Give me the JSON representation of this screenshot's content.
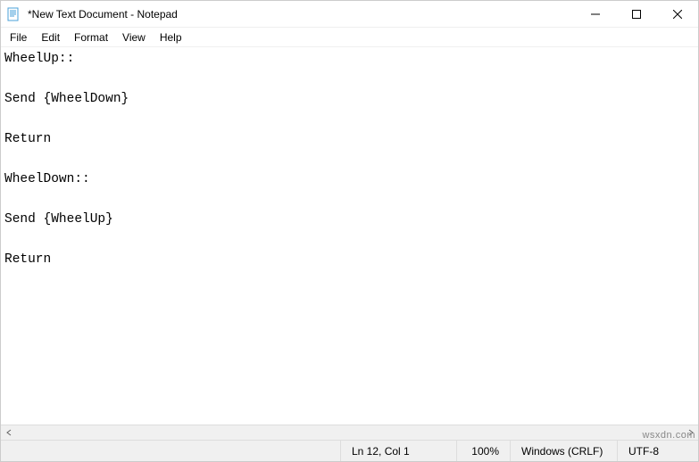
{
  "window": {
    "title": "*New Text Document - Notepad"
  },
  "menu": {
    "items": [
      "File",
      "Edit",
      "Format",
      "View",
      "Help"
    ]
  },
  "editor": {
    "content": "WheelUp::\n\nSend {WheelDown}\n\nReturn\n\nWheelDown::\n\nSend {WheelUp}\n\nReturn"
  },
  "status": {
    "position": "Ln 12, Col 1",
    "zoom": "100%",
    "line_ending": "Windows (CRLF)",
    "encoding": "UTF-8"
  },
  "watermark": "wsxdn.com"
}
